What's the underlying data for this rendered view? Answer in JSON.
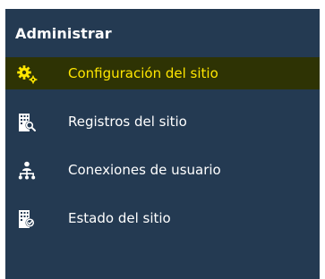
{
  "panel": {
    "title": "Administrar"
  },
  "nav": {
    "items": [
      {
        "label": "Configuración del sitio",
        "icon": "gears-icon",
        "active": true
      },
      {
        "label": "Registros del sitio",
        "icon": "building-search-icon",
        "active": false
      },
      {
        "label": "Conexiones de usuario",
        "icon": "user-network-icon",
        "active": false
      },
      {
        "label": "Estado del sitio",
        "icon": "building-status-icon",
        "active": false
      }
    ]
  },
  "colors": {
    "panel_background": "#243a52",
    "active_background": "#2e3304",
    "active_text": "#ffe600",
    "text": "#ffffff"
  }
}
